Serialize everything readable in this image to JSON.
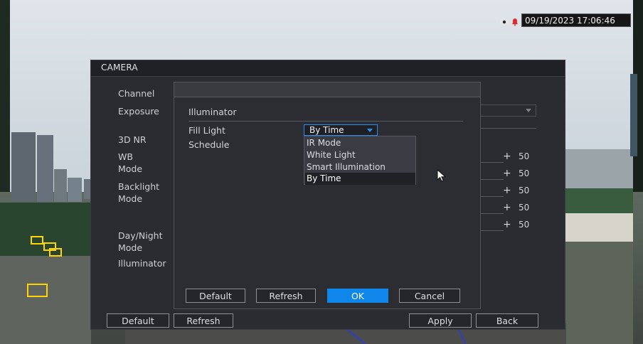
{
  "overlay": {
    "datetime": "09/19/2023 17:06:46",
    "status_icons": [
      "recording-eye-icon",
      "alarm-bell-icon"
    ]
  },
  "camera_window": {
    "title": "CAMERA",
    "labels": [
      "Channel",
      "Exposure",
      "3D NR",
      "WB Mode",
      "Backlight Mode",
      "Day/Night Mode",
      "Illuminator"
    ],
    "slider_values": [
      "50",
      "50",
      "50",
      "50",
      "50"
    ],
    "buttons": {
      "default": "Default",
      "refresh": "Refresh",
      "apply": "Apply",
      "back": "Back"
    }
  },
  "illuminator_dialog": {
    "header": "Illuminator",
    "fill_light_label": "Fill Light",
    "schedule_label": "Schedule",
    "fill_light_value": "By Time",
    "options": [
      "IR Mode",
      "White Light",
      "Smart Illumination",
      "By Time"
    ],
    "selected_option": "By Time",
    "buttons": {
      "default": "Default",
      "refresh": "Refresh",
      "ok": "OK",
      "cancel": "Cancel"
    }
  }
}
